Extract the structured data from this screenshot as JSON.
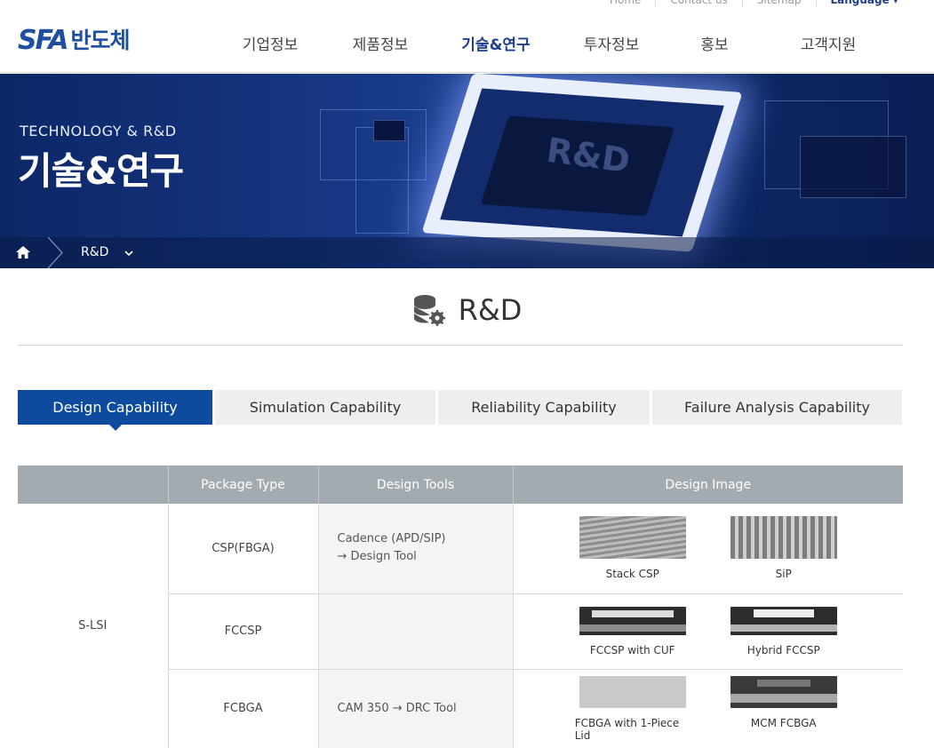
{
  "util": {
    "home": "Home",
    "contact": "Contact us",
    "sitemap": "Sitemap",
    "language": "Language ▾"
  },
  "logo": {
    "brand": "SFA",
    "kr": "반도체"
  },
  "nav": [
    {
      "label": "기업정보"
    },
    {
      "label": "제품정보"
    },
    {
      "label": "기술&연구",
      "active": true
    },
    {
      "label": "투자정보"
    },
    {
      "label": "홍보"
    },
    {
      "label": "고객지원"
    }
  ],
  "banner": {
    "subtitle": "TECHNOLOGY & R&D",
    "title": "기술&연구",
    "chip_text": "R&D"
  },
  "breadcrumb": {
    "current": "R&D"
  },
  "page_title": "R&D",
  "tabs": [
    {
      "label": "Design Capability",
      "active": true
    },
    {
      "label": "Simulation Capability"
    },
    {
      "label": "Reliability Capability"
    },
    {
      "label": "Failure Analysis Capability"
    }
  ],
  "table": {
    "headers": [
      "",
      "Package Type",
      "Design Tools",
      "Design Image"
    ],
    "category": "S-LSI",
    "rows": [
      {
        "package": "CSP(FBGA)",
        "tool_line1": "Cadence (APD/SIP)",
        "tool_line2": "→ Design Tool",
        "images": [
          "Stack CSP",
          "SiP"
        ]
      },
      {
        "package": "FCCSP",
        "tool_line1": "",
        "tool_line2": "",
        "images": [
          "FCCSP with CUF",
          "Hybrid FCCSP"
        ]
      },
      {
        "package": "FCBGA",
        "tool_line1": "CAM 350 → DRC Tool",
        "tool_line2": "",
        "images": [
          "FCBGA with 1-Piece Lid",
          "MCM FCBGA"
        ]
      }
    ]
  },
  "colors": {
    "brand": "#1f4fa0",
    "tab_active": "#0e4b9e",
    "table_header": "#a3aab0"
  }
}
